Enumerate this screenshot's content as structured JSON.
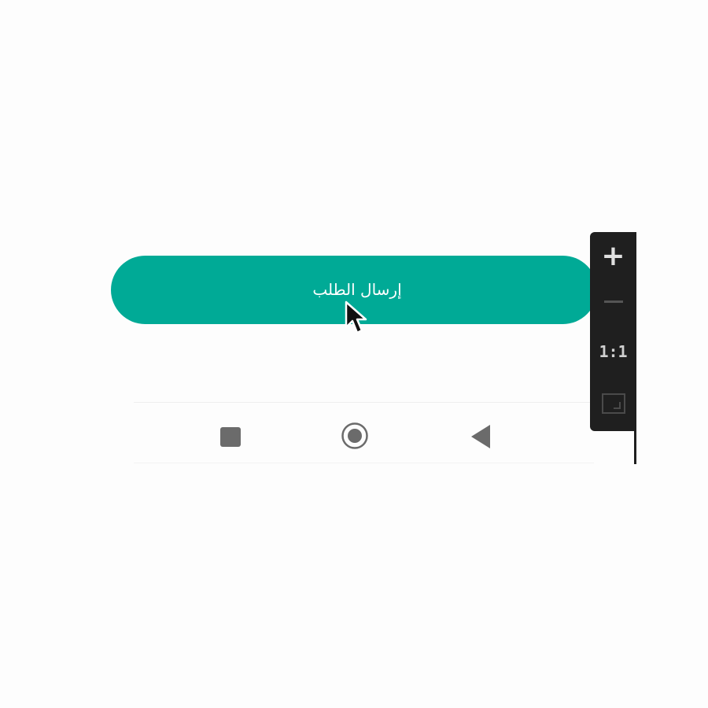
{
  "form": {
    "submit_label": "إرسال الطلب",
    "accent_color": "#00aa96"
  },
  "nav_bar": {
    "recents_icon": "square-icon",
    "home_icon": "circle-home-icon",
    "back_icon": "triangle-back-icon"
  },
  "zoom_controls": {
    "zoom_in_label": "+",
    "reset_label": "1:1",
    "zoom_out_icon": "minus-icon",
    "fit_icon": "fit-screen-icon",
    "panel_color": "#1f1f1f"
  },
  "cursor_icon": "arrow-cursor-icon"
}
